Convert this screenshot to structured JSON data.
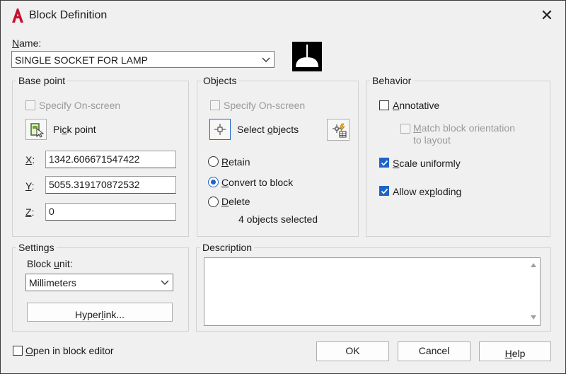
{
  "window": {
    "title": "Block Definition",
    "close_glyph": "✕"
  },
  "name": {
    "label_prefix": "N",
    "label_rest": "ame:",
    "value": "SINGLE SOCKET FOR LAMP"
  },
  "base_point": {
    "group_label": "Base point",
    "specify_on_screen": "Specify On-screen",
    "pick_point_pre": "Pi",
    "pick_point_u": "c",
    "pick_point_post": "k point",
    "x_label_u": "X",
    "x_label_rest": ":",
    "x_value": "1342.606671547422",
    "y_label_u": "Y",
    "y_label_rest": ":",
    "y_value": "5055.319170872532",
    "z_label_u": "Z",
    "z_label_rest": ":",
    "z_value": "0"
  },
  "objects": {
    "group_label": "Objects",
    "specify_on_screen": "Specify On-screen",
    "select_objects_pre": "Select ",
    "select_objects_u": "o",
    "select_objects_post": "bjects",
    "retain_u": "R",
    "retain_rest": "etain",
    "convert_u": "C",
    "convert_rest": "onvert to block",
    "delete_u": "D",
    "delete_rest": "elete",
    "selected_count": "4 objects selected",
    "selection_mode": "Convert to block"
  },
  "behavior": {
    "group_label": "Behavior",
    "annotative_u": "A",
    "annotative_rest": "nnotative",
    "annotative_checked": false,
    "match_u": "M",
    "match_rest": "atch block orientation",
    "match_line2": "to layout",
    "match_checked": false,
    "scale_u": "S",
    "scale_rest": "cale uniformly",
    "scale_checked": true,
    "explode_pre": "Allow ex",
    "explode_u": "p",
    "explode_post": "loding",
    "explode_checked": true
  },
  "settings": {
    "group_label": "Settings",
    "block_unit_pre": "Block ",
    "block_unit_u": "u",
    "block_unit_post": "nit:",
    "block_unit_value": "Millimeters",
    "hyperlink_pre": "Hyper",
    "hyperlink_u": "l",
    "hyperlink_post": "ink..."
  },
  "description": {
    "group_label": "Description",
    "value": ""
  },
  "footer": {
    "open_editor_u": "O",
    "open_editor_rest": "pen in block editor",
    "open_editor_checked": false,
    "ok": "OK",
    "cancel": "Cancel",
    "help_u": "H",
    "help_rest": "elp"
  },
  "colors": {
    "accent": "#1e64c8",
    "app_red": "#c8102e",
    "dialog_bg": "#f0f0f0"
  },
  "icons": [
    "autocad-logo-icon",
    "close-icon",
    "block-preview-icon",
    "pick-point-icon",
    "select-objects-icon",
    "quick-select-icon",
    "chevron-down-icon",
    "scroll-up-icon",
    "scroll-down-icon",
    "checkmark-icon"
  ]
}
